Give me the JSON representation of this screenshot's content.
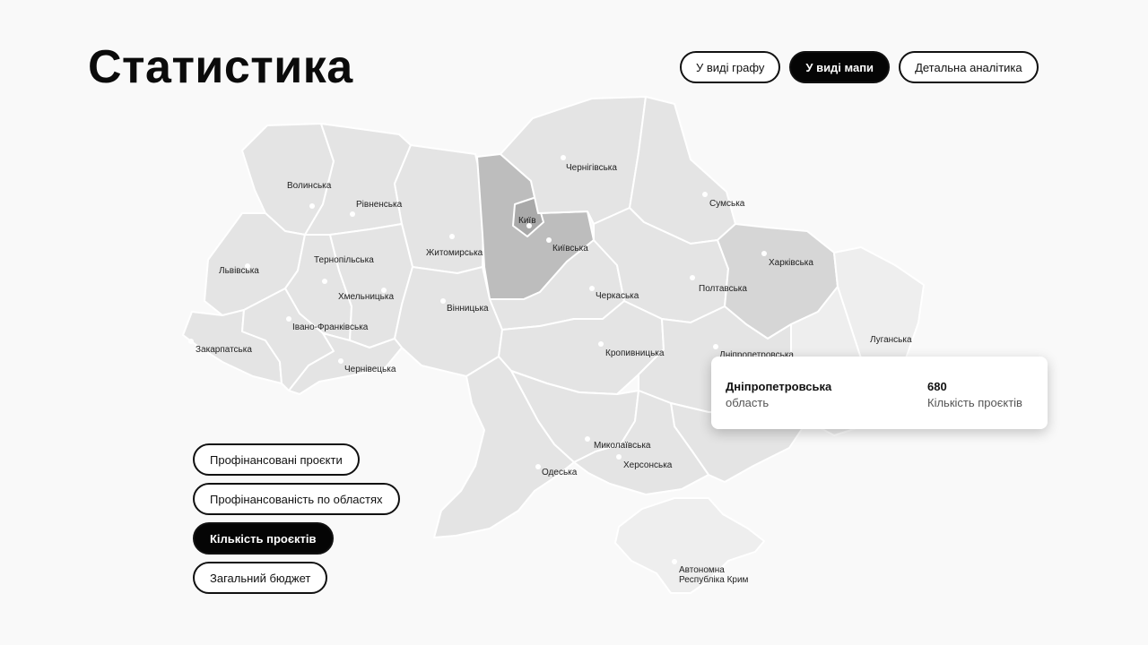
{
  "page": {
    "title": "Статистика"
  },
  "view_switch": [
    {
      "label": "У виді графу",
      "active": false
    },
    {
      "label": "У виді мапи",
      "active": true
    },
    {
      "label": "Детальна аналітика",
      "active": false
    }
  ],
  "metrics": [
    {
      "label": "Профінансовані проєкти",
      "active": false
    },
    {
      "label": "Профінансованість по областях",
      "active": false
    },
    {
      "label": "Кількість проєктів",
      "active": true
    },
    {
      "label": "Загальний бюджет",
      "active": false
    }
  ],
  "map": {
    "colors": {
      "light": "#e4e4e4",
      "lighter": "#eeeeee",
      "mid": "#d6d6d6",
      "dark": "#a9a9a9",
      "kyiv_region": "#bdbdbd",
      "border": "#ffffff"
    },
    "regions": [
      {
        "label": "Волинська"
      },
      {
        "label": "Рівненська"
      },
      {
        "label": "Житомирська"
      },
      {
        "label": "Київ"
      },
      {
        "label": "Київська"
      },
      {
        "label": "Чернігівська"
      },
      {
        "label": "Сумська"
      },
      {
        "label": "Львівська"
      },
      {
        "label": "Тернопільська"
      },
      {
        "label": "Хмельницька"
      },
      {
        "label": "Вінницька"
      },
      {
        "label": "Черкаська"
      },
      {
        "label": "Полтавська"
      },
      {
        "label": "Харківська"
      },
      {
        "label": "Луганська"
      },
      {
        "label": "Закарпатська"
      },
      {
        "label": "Івано-Франківська"
      },
      {
        "label": "Чернівецька"
      },
      {
        "label": "Кропивницька"
      },
      {
        "label": "Дніпропетровська"
      },
      {
        "label": "Миколаївська"
      },
      {
        "label": "Херсонська"
      },
      {
        "label": "Одеська"
      },
      {
        "label": "Автономна"
      },
      {
        "label": "Республіка Крим"
      }
    ]
  },
  "tooltip": {
    "region": "Дніпропетровська",
    "region_sub": "область",
    "value": "680",
    "metric": "Кількість проєктів"
  }
}
